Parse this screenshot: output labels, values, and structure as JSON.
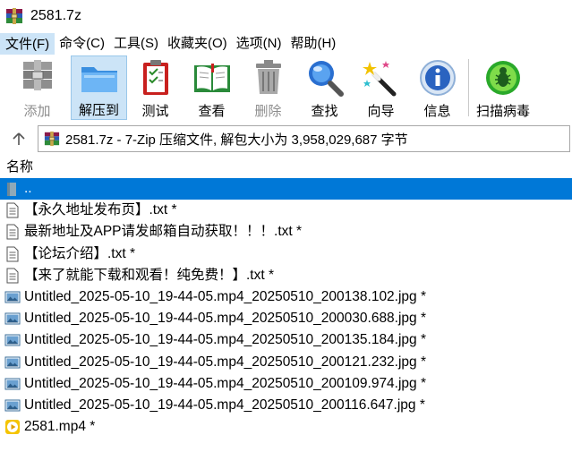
{
  "window": {
    "title": "2581.7z"
  },
  "menu": [
    "文件(F)",
    "命令(C)",
    "工具(S)",
    "收藏夹(O)",
    "选项(N)",
    "帮助(H)"
  ],
  "toolbar": {
    "add": "添加",
    "extract": "解压到",
    "test": "测试",
    "view": "查看",
    "delete": "删除",
    "find": "查找",
    "wizard": "向导",
    "info": "信息",
    "virus_scan": "扫描病毒"
  },
  "address": {
    "text": "2581.7z - 7-Zip 压缩文件, 解包大小为 3,958,029,687 字节"
  },
  "list": {
    "column_name": "名称",
    "items": [
      {
        "name": "..",
        "type": "parent"
      },
      {
        "name": "【永久地址发布页】.txt *",
        "type": "txt"
      },
      {
        "name": "最新地址及APP请发邮箱自动获取！！！.txt *",
        "type": "txt"
      },
      {
        "name": "【论坛介绍】.txt *",
        "type": "txt"
      },
      {
        "name": "【来了就能下载和观看！纯免费！】.txt *",
        "type": "txt"
      },
      {
        "name": "Untitled_2025-05-10_19-44-05.mp4_20250510_200138.102.jpg *",
        "type": "jpg"
      },
      {
        "name": "Untitled_2025-05-10_19-44-05.mp4_20250510_200030.688.jpg *",
        "type": "jpg"
      },
      {
        "name": "Untitled_2025-05-10_19-44-05.mp4_20250510_200135.184.jpg *",
        "type": "jpg"
      },
      {
        "name": "Untitled_2025-05-10_19-44-05.mp4_20250510_200121.232.jpg *",
        "type": "jpg"
      },
      {
        "name": "Untitled_2025-05-10_19-44-05.mp4_20250510_200109.974.jpg *",
        "type": "jpg"
      },
      {
        "name": "Untitled_2025-05-10_19-44-05.mp4_20250510_200116.647.jpg *",
        "type": "jpg"
      },
      {
        "name": "2581.mp4 *",
        "type": "mp4"
      }
    ]
  },
  "colors": {
    "selection": "#0078d7",
    "pressed": "#cce4f7"
  }
}
